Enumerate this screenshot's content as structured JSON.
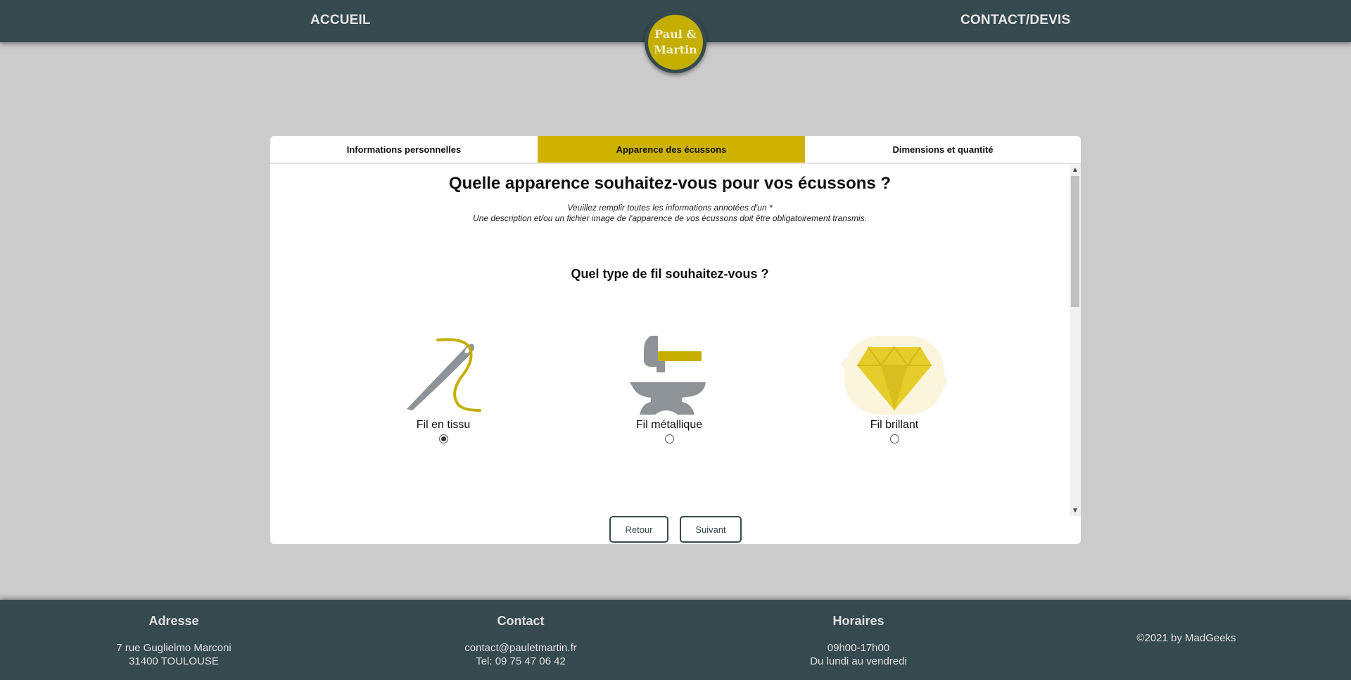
{
  "header": {
    "nav_home": "ACCUEIL",
    "nav_contact": "CONTACT/DEVIS",
    "logo_line1": "Paul &",
    "logo_line2": "Martin",
    "bg_color": "#354a4e",
    "logo_color": "#c4ae00"
  },
  "tabs": [
    {
      "label": "Informations personnelles",
      "active": false
    },
    {
      "label": "Apparence des écussons",
      "active": true
    },
    {
      "label": "Dimensions et quantité",
      "active": false
    }
  ],
  "form": {
    "title": "Quelle apparence souhaitez-vous pour vos écussons ?",
    "note1": "Veuillez remplir toutes les informations annotées d'un *",
    "note2": "Une description et/ou un fichier image de l'apparence de vos écussons doit être obligatoirement transmis.",
    "question": "Quel type de fil souhaitez-vous ?",
    "options": [
      {
        "label": "Fil en tissu",
        "icon": "needle-thread-icon",
        "selected": true
      },
      {
        "label": "Fil métallique",
        "icon": "anvil-hammer-icon",
        "selected": false
      },
      {
        "label": "Fil brillant",
        "icon": "diamond-icon",
        "selected": false
      }
    ],
    "back_label": "Retour",
    "next_label": "Suivant",
    "accent_color": "#cdb200"
  },
  "footer": {
    "address_title": "Adresse",
    "address_line1": "7 rue Guglielmo Marconi",
    "address_line2": "31400 TOULOUSE",
    "contact_title": "Contact",
    "contact_email": "contact@pauletmartin.fr",
    "contact_phone": "Tel: 09 75 47 06 42",
    "hours_title": "Horaires",
    "hours_line1": "09h00-17h00",
    "hours_line2": "Du lundi au vendredi",
    "copyright": "©2021 by MadGeeks"
  }
}
